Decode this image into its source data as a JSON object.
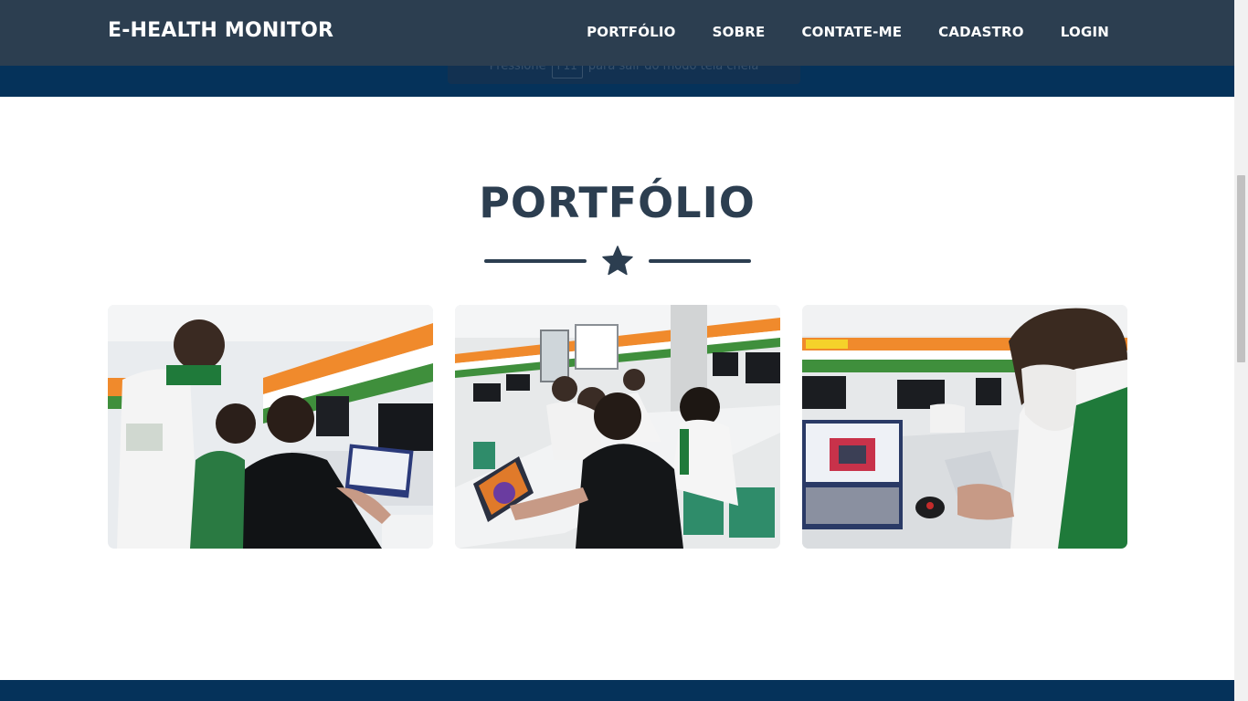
{
  "navbar": {
    "brand": "E-HEALTH MONITOR",
    "links": [
      {
        "label": "PORTFÓLIO"
      },
      {
        "label": "SOBRE"
      },
      {
        "label": "CONTATE-ME"
      },
      {
        "label": "CADASTRO"
      },
      {
        "label": "LOGIN"
      }
    ]
  },
  "fullscreen_notice": {
    "before": "Pressione",
    "key": "F11",
    "after": "para sair do modo tela cheia"
  },
  "portfolio": {
    "title": "PORTFÓLIO",
    "divider_icon": "star-icon"
  },
  "colors": {
    "navbar_bg": "#2c3e50",
    "header_band": "#05325a",
    "title_color": "#2c3e50",
    "wall_orange": "#f08a2c",
    "wall_green": "#3f8f3c",
    "uniform_green": "#1f7a3a"
  }
}
